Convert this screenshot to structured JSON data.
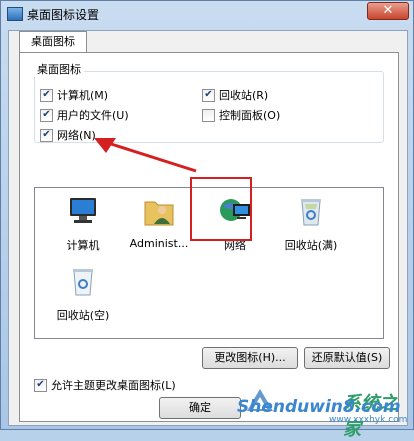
{
  "window": {
    "title": "桌面图标设置",
    "close_glyph": "✕"
  },
  "tab": {
    "label": "桌面图标"
  },
  "group": {
    "label": "桌面图标"
  },
  "checkboxes": [
    {
      "label": "计算机(M)",
      "checked": true
    },
    {
      "label": "回收站(R)",
      "checked": true
    },
    {
      "label": "用户的文件(U)",
      "checked": true
    },
    {
      "label": "控制面板(O)",
      "checked": false
    },
    {
      "label": "网络(N)",
      "checked": true
    }
  ],
  "icons": [
    {
      "label": "计算机",
      "icon": "computer-icon"
    },
    {
      "label": "Administ...",
      "icon": "user-folder-icon"
    },
    {
      "label": "网络",
      "icon": "network-globe-icon",
      "selected": true
    },
    {
      "label": "回收站(满)",
      "icon": "recycle-bin-full-icon"
    },
    {
      "label": "回收站(空)",
      "icon": "recycle-bin-empty-icon"
    }
  ],
  "buttons": {
    "change_icon": "更改图标(H)...",
    "restore_default": "还原默认值(S)",
    "ok": "确定"
  },
  "allow_theme": {
    "label": "允许主题更改桌面图标(L)",
    "checked": true
  },
  "watermark": {
    "text": "Shenduwin8.com",
    "subtext": "www.xxxhyk.com",
    "logo_text": "系统之家"
  },
  "colors": {
    "annotation_red": "#d42020",
    "title_blue": "#2f6fb6"
  }
}
